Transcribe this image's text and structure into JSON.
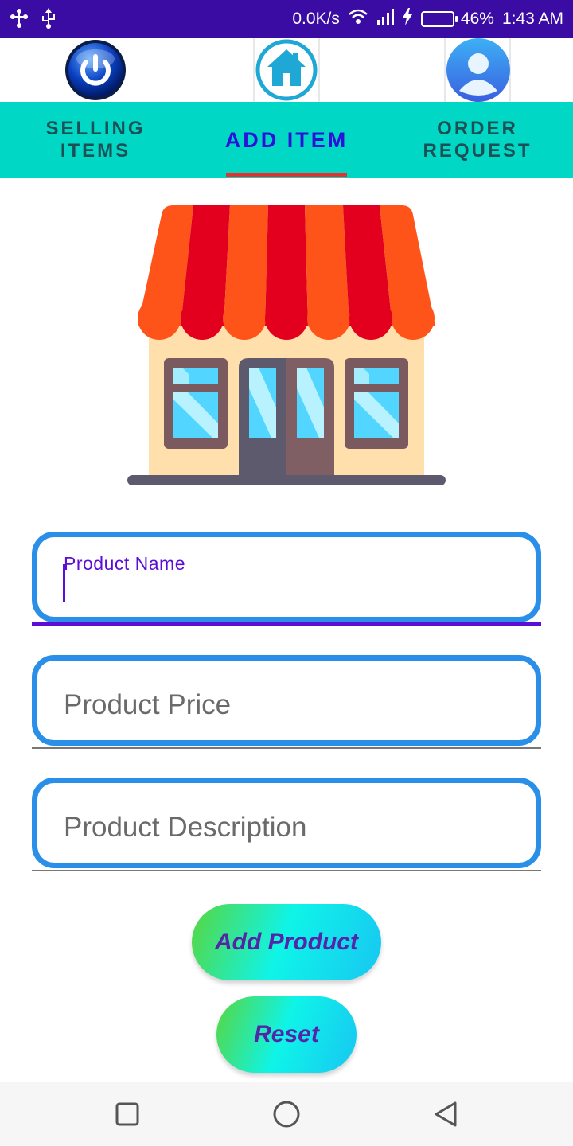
{
  "status_bar": {
    "left_icons": [
      "usb-debug-icon",
      "usb-icon"
    ],
    "net_speed": "0.0K/s",
    "battery_percent": "46%",
    "time": "1:43 AM",
    "battery_level": 0.46
  },
  "top_icons": [
    {
      "name": "power-icon"
    },
    {
      "name": "home-icon"
    },
    {
      "name": "profile-icon"
    }
  ],
  "tabs": [
    {
      "line1": "SELLING",
      "line2": "ITEMS"
    },
    {
      "line1": "ADD ITEM",
      "line2": ""
    },
    {
      "line1": "ORDER",
      "line2": "REQUEST"
    }
  ],
  "active_tab": "ADD ITEM",
  "form": {
    "product_name_label": "Product Name",
    "product_name_value": "",
    "product_price_placeholder": "Product Price",
    "product_description_placeholder": "Product Description"
  },
  "buttons": {
    "add_product": "Add Product",
    "reset": "Reset"
  },
  "nav": [
    "recents-icon",
    "home-circle-icon",
    "back-icon"
  ],
  "colors": {
    "status_bar": "#3a0ca3",
    "tab_bar": "#00d7c5",
    "active_tab_text": "#2c12d8",
    "tab_indicator": "#e8302e",
    "field_border": "#2a8fe8",
    "button_text": "#5326a8"
  }
}
